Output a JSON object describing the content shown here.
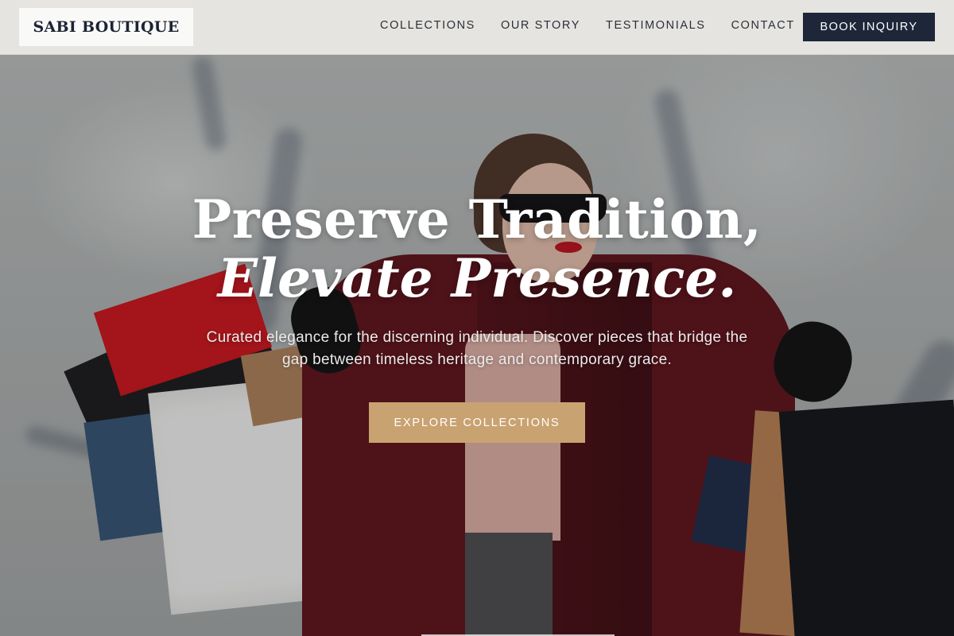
{
  "brand": {
    "name": "SABI BOUTIQUE"
  },
  "nav": {
    "links": [
      {
        "label": "COLLECTIONS"
      },
      {
        "label": "OUR STORY"
      },
      {
        "label": "TESTIMONIALS"
      },
      {
        "label": "CONTACT"
      }
    ],
    "cta_label": "BOOK INQUIRY"
  },
  "hero": {
    "headline_line1": "Preserve Tradition,",
    "headline_line2": "Elevate Presence.",
    "subtitle": "Curated elegance for the discerning individual. Discover pieces that bridge the gap between timeless heritage and contemporary grace.",
    "cta_label": "EXPLORE COLLECTIONS",
    "background_image": "woman-with-shopping-bags"
  },
  "colors": {
    "navy": "#1d2739",
    "gold": "#c9a271",
    "nav_bg": "#e8e7e3"
  }
}
